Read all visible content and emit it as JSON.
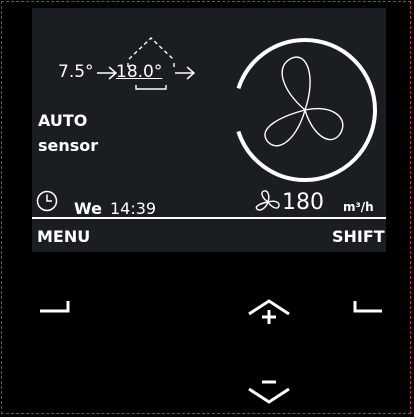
{
  "display": {
    "temps": {
      "outdoor": "7.5°",
      "setpoint": "18.0°"
    },
    "mode": {
      "line1": "AUTO",
      "line2": "sensor"
    },
    "schedule": {
      "day": "We",
      "time": "14:39"
    },
    "airflow": {
      "value": "180",
      "unit": "m³/h",
      "level_fraction": 0.9
    },
    "softkeys": {
      "left": "MENU",
      "right": "SHIFT"
    }
  },
  "icons": {
    "clock": "clock-icon",
    "house": "house-icon",
    "fan": "fan-icon",
    "fan_small": "fan-small-icon",
    "arrows": "arrow-right-icon"
  },
  "colors": {
    "display_bg": "#1a1d21",
    "housing": "#000000",
    "foreground": "#ffffff"
  }
}
